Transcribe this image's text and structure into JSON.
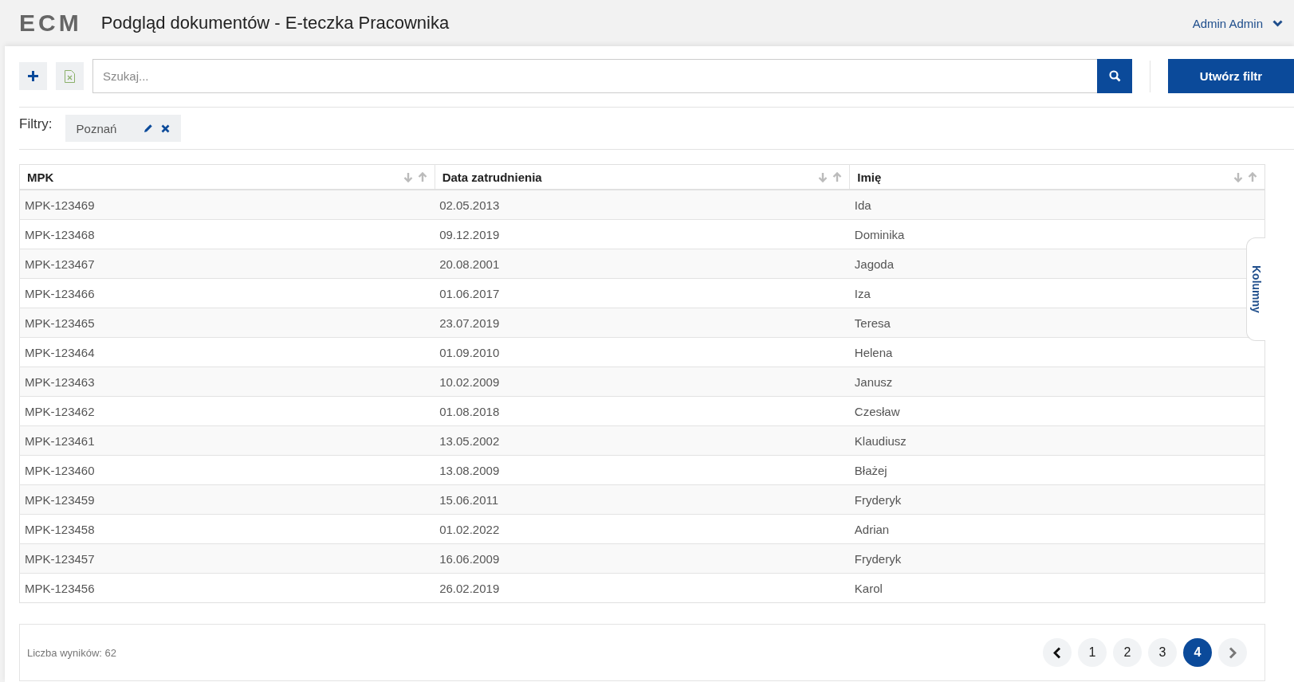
{
  "header": {
    "logo": "ECM",
    "title": "Podgląd dokumentów - E-teczka Pracownika",
    "user": "Admin Admin"
  },
  "toolbar": {
    "search": {
      "placeholder": "Szukaj..."
    },
    "create_filter_button": "Utwórz filtr"
  },
  "filters": {
    "label": "Filtry:",
    "chips": [
      "Poznań"
    ]
  },
  "table": {
    "columns": [
      "MPK",
      "Data zatrudnienia",
      "Imię"
    ],
    "rows": [
      [
        "MPK-123469",
        "02.05.2013",
        "Ida"
      ],
      [
        "MPK-123468",
        "09.12.2019",
        "Dominika"
      ],
      [
        "MPK-123467",
        "20.08.2001",
        "Jagoda"
      ],
      [
        "MPK-123466",
        "01.06.2017",
        "Iza"
      ],
      [
        "MPK-123465",
        "23.07.2019",
        "Teresa"
      ],
      [
        "MPK-123464",
        "01.09.2010",
        "Helena"
      ],
      [
        "MPK-123463",
        "10.02.2009",
        "Janusz"
      ],
      [
        "MPK-123462",
        "01.08.2018",
        "Czesław"
      ],
      [
        "MPK-123461",
        "13.05.2002",
        "Klaudiusz"
      ],
      [
        "MPK-123460",
        "13.08.2009",
        "Błażej"
      ],
      [
        "MPK-123459",
        "15.06.2011",
        "Fryderyk"
      ],
      [
        "MPK-123458",
        "01.02.2022",
        "Adrian"
      ],
      [
        "MPK-123457",
        "16.06.2009",
        "Fryderyk"
      ],
      [
        "MPK-123456",
        "26.02.2019",
        "Karol"
      ]
    ],
    "columns_tab": "Kolumny"
  },
  "footer": {
    "result_count": "Liczba wyników: 62",
    "pagination": {
      "prev_disabled": false,
      "next_disabled": true,
      "pages": [
        {
          "label": "1",
          "selected": false
        },
        {
          "label": "2",
          "selected": false
        },
        {
          "label": "3",
          "selected": false
        },
        {
          "label": "4",
          "selected": true
        }
      ]
    }
  }
}
